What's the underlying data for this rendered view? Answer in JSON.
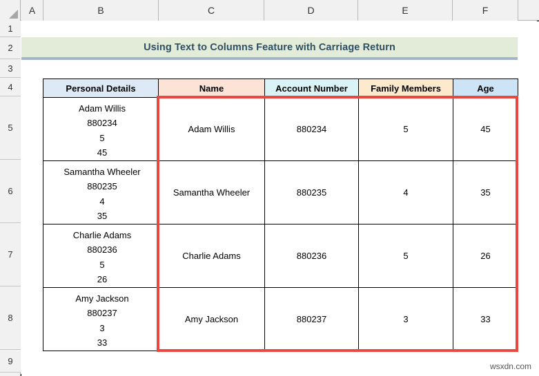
{
  "spreadsheet": {
    "column_headers": [
      "A",
      "B",
      "C",
      "D",
      "E",
      "F"
    ],
    "row_headers": [
      "1",
      "2",
      "3",
      "4",
      "5",
      "6",
      "7",
      "8",
      "9"
    ],
    "title": "Using Text to Columns Feature with Carriage Return",
    "watermark": "wsxdn.com",
    "colors": {
      "title_background": "#e3ebd9",
      "title_underline": "#a3b5cd",
      "title_text": "#2f4f63",
      "header_personal_details": "#ddeaf6",
      "header_name": "#fce3d5",
      "header_account_number": "#d9f3f7",
      "header_family_members": "#fdeacd",
      "header_age": "#cde4f7",
      "selection_highlight": "#e8483f",
      "grid_header_bg": "#f1f1f1"
    }
  },
  "table": {
    "headers": [
      "Personal Details",
      "Name",
      "Account Number",
      "Family Members",
      "Age"
    ],
    "rows": [
      {
        "personal_details": "Adam Willis\n880234\n5\n45",
        "name": "Adam Willis",
        "account_number": "880234",
        "family_members": "5",
        "age": "45"
      },
      {
        "personal_details": "Samantha Wheeler\n880235\n4\n35",
        "name": "Samantha Wheeler",
        "account_number": "880235",
        "family_members": "4",
        "age": "35"
      },
      {
        "personal_details": "Charlie Adams\n880236\n5\n26",
        "name": "Charlie Adams",
        "account_number": "880236",
        "family_members": "5",
        "age": "26"
      },
      {
        "personal_details": "Amy Jackson\n880237\n3\n33",
        "name": "Amy Jackson",
        "account_number": "880237",
        "family_members": "3",
        "age": "33"
      }
    ]
  }
}
